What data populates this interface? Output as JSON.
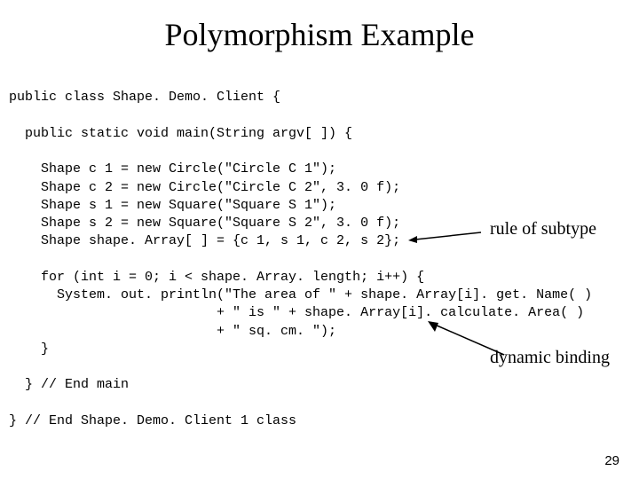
{
  "title": "Polymorphism Example",
  "code": {
    "l1": "public class Shape. Demo. Client {",
    "l2": "  public static void main(String argv[ ]) {",
    "l3": "    Shape c 1 = new Circle(\"Circle C 1\");",
    "l4": "    Shape c 2 = new Circle(\"Circle C 2\", 3. 0 f);",
    "l5": "    Shape s 1 = new Square(\"Square S 1\");",
    "l6": "    Shape s 2 = new Square(\"Square S 2\", 3. 0 f);",
    "l7": "    Shape shape. Array[ ] = {c 1, s 1, c 2, s 2};",
    "l8": "    for (int i = 0; i < shape. Array. length; i++) {",
    "l9": "      System. out. println(\"The area of \" + shape. Array[i]. get. Name( )",
    "l10": "                          + \" is \" + shape. Array[i]. calculate. Area( )",
    "l11": "                          + \" sq. cm. \");",
    "l12": "    }",
    "l13": "  } // End main",
    "l14": "} // End Shape. Demo. Client 1 class"
  },
  "annotations": {
    "subtype": "rule of subtype",
    "dynamic": "dynamic binding"
  },
  "page_number": "29"
}
